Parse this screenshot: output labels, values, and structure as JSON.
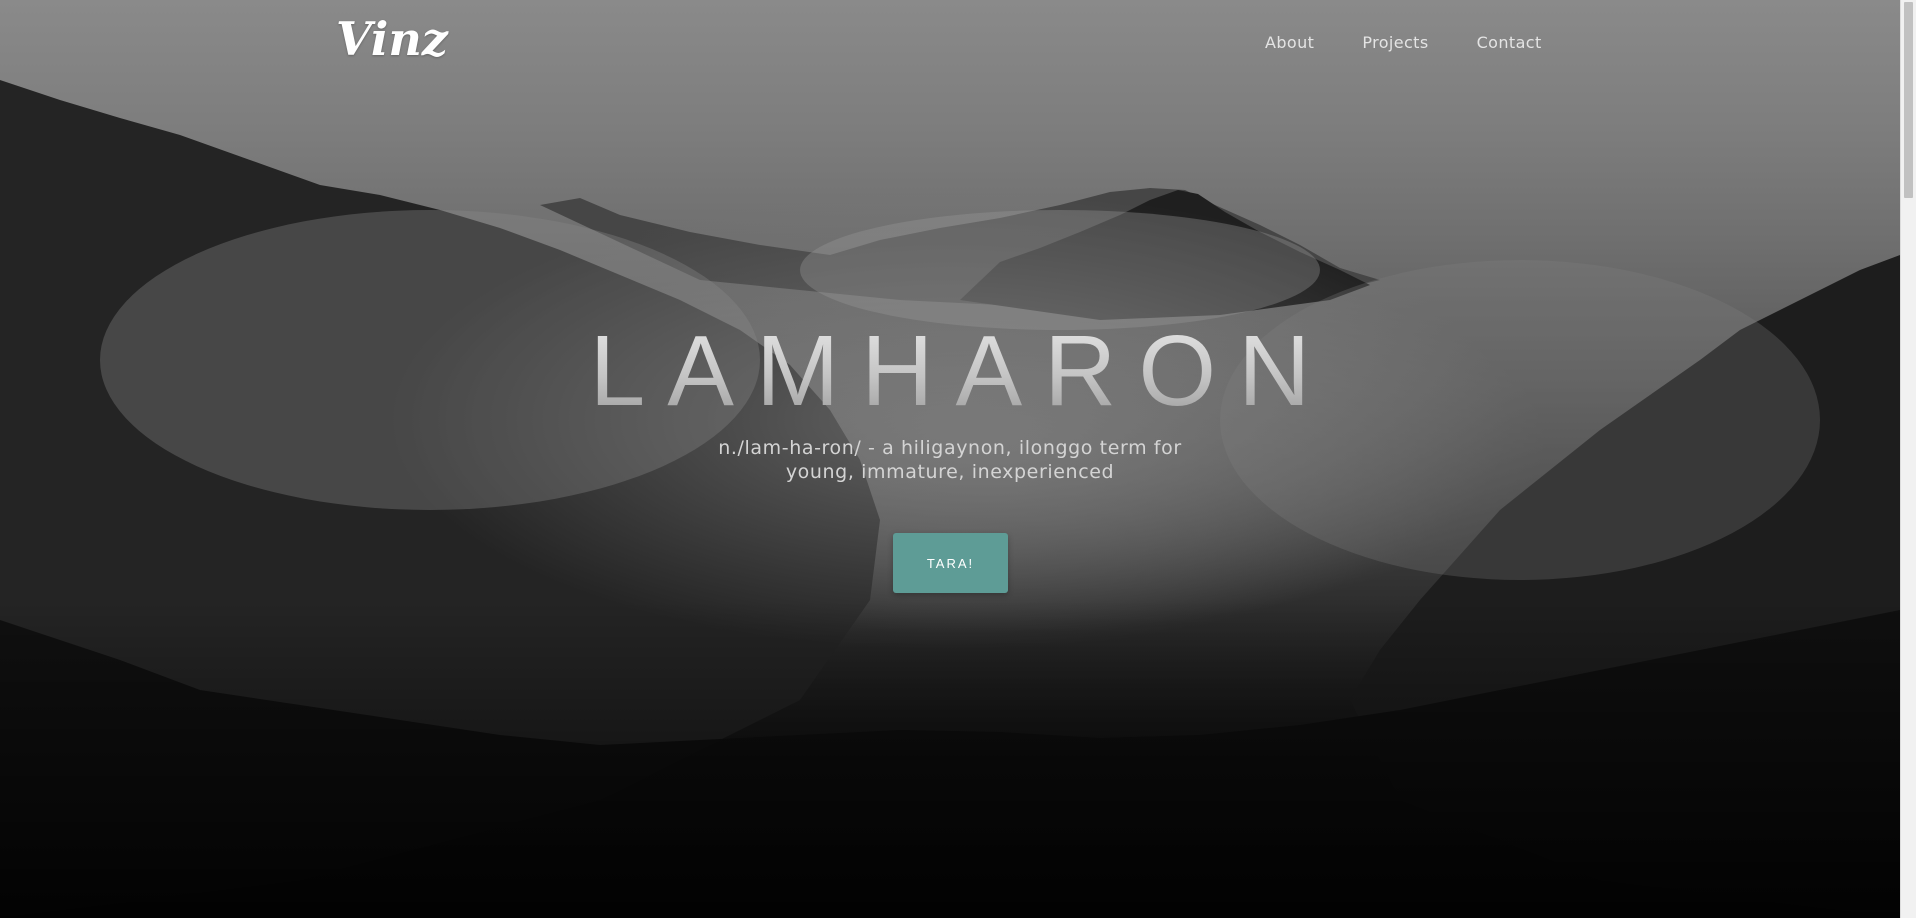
{
  "header": {
    "logo": "Vinz",
    "nav": [
      {
        "label": "About"
      },
      {
        "label": "Projects"
      },
      {
        "label": "Contact"
      }
    ]
  },
  "hero": {
    "title": "LAMHARON",
    "subtitle_line1": "n./lam-ha-ron/ - a hiligaynon, ilonggo term for",
    "subtitle_line2": "young, immature, inexperienced",
    "cta_label": "TARA!"
  },
  "colors": {
    "cta_background": "#5e9c96",
    "nav_text": "#e4e4e4",
    "title_text": "#c4c4c4"
  }
}
